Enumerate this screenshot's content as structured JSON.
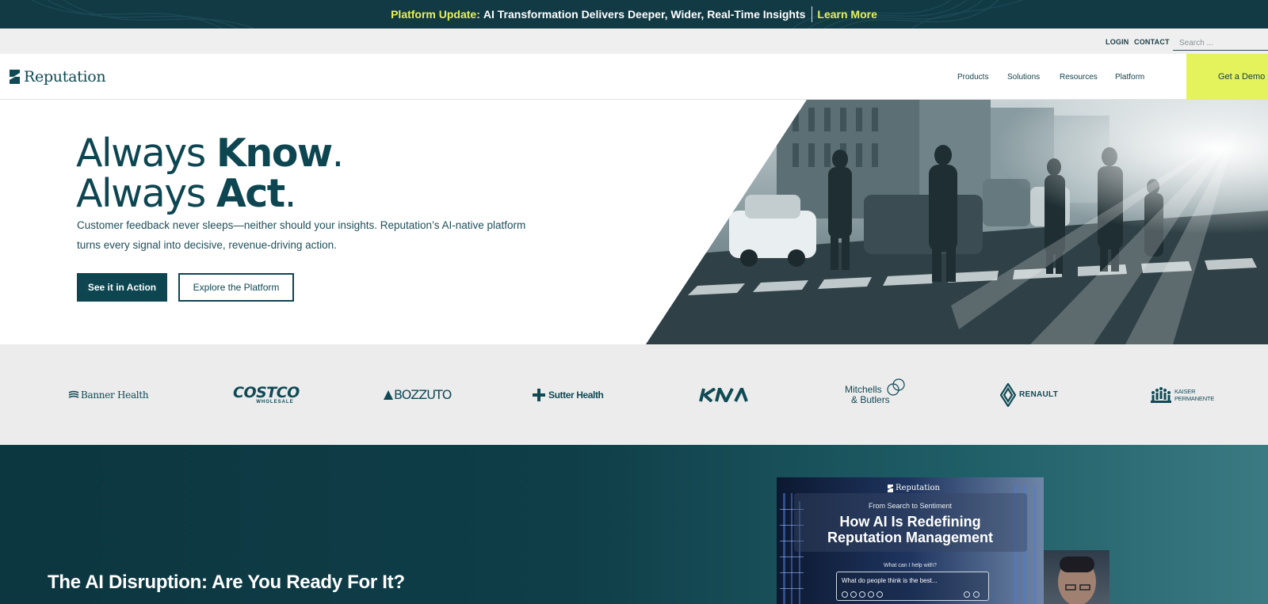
{
  "announcement": {
    "highlight": "Platform Update:",
    "text": "AI Transformation Delivers Deeper, Wider, Real-Time Insights",
    "link": "Learn More"
  },
  "utility": {
    "login": "LOGIN",
    "contact": "CONTACT",
    "search_placeholder": "Search ..."
  },
  "nav": {
    "logo": "Reputation",
    "items": [
      "Products",
      "Solutions",
      "Resources",
      "Platform"
    ],
    "cta": "Get a Demo"
  },
  "hero": {
    "line1_light": "Always ",
    "line1_bold": "Know",
    "line1_end": ".",
    "line2_light": "Always ",
    "line2_bold": "Act",
    "line2_end": ".",
    "subtitle": "Customer feedback never sleeps—neither should your insights. Reputation’s AI-native platform turns every signal into decisive, revenue-driving action.",
    "primary_button": "See it in Action",
    "secondary_button": "Explore the Platform"
  },
  "logos": {
    "banner_health": "Banner Health",
    "costco": "COSTCO",
    "costco_sub": "WHOLESALE",
    "bozzuto": "BOZZUTO",
    "sutter": "Sutter Health",
    "kia": "KIA",
    "mitchells_1": "Mitchells",
    "mitchells_2": "& Butlers",
    "renault": "RENAULT",
    "kaiser_1": "KAISER",
    "kaiser_2": "PERMANENTE"
  },
  "feature": {
    "title": "The AI Disruption: Are You Ready For It?",
    "promo": {
      "logo": "Reputation",
      "kicker": "From Search to Sentiment",
      "title_line1": "How AI Is Redefining",
      "title_line2": "Reputation Management",
      "help": "What can I help with?",
      "prompt": "What do people think is the best..."
    }
  },
  "colors": {
    "brand_teal": "#0d4651",
    "accent_lime": "#e4f35b",
    "announce_bg": "#113a45"
  }
}
